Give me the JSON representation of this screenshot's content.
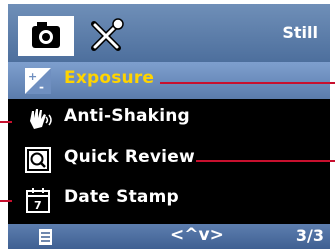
{
  "header": {
    "tabs": [
      {
        "icon": "camera-icon",
        "selected": true
      },
      {
        "icon": "tools-icon",
        "selected": false
      }
    ],
    "mode_label": "Still"
  },
  "menu": {
    "items": [
      {
        "label": "Exposure",
        "icon": "exposure-icon",
        "selected": true
      },
      {
        "label": "Anti-Shaking",
        "icon": "anti-shake-hand-icon",
        "selected": false
      },
      {
        "label": "Quick Review",
        "icon": "quick-review-icon",
        "selected": false
      },
      {
        "label": "Date Stamp",
        "icon": "calendar-icon",
        "selected": false
      }
    ]
  },
  "footer": {
    "icon": "menu-doc-icon",
    "nav": "<^v>",
    "page": "3/3"
  },
  "colors": {
    "selection": "#6f8fc0",
    "selected_text": "#ffd400",
    "callout": "#c8102e"
  }
}
